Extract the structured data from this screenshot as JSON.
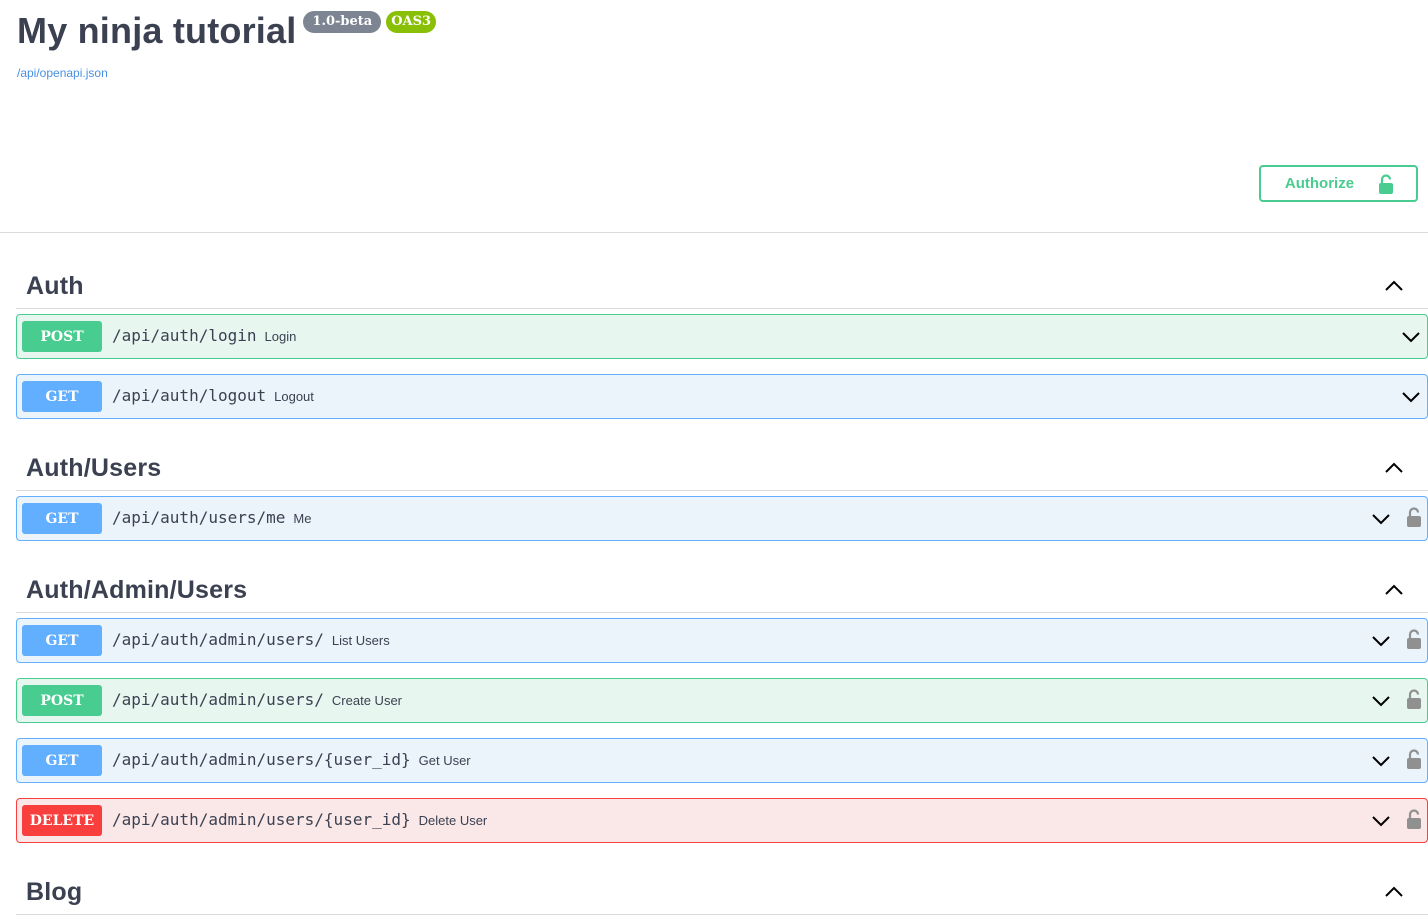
{
  "header": {
    "title": "My ninja tutorial",
    "version_badge": "1.0-beta",
    "oas_badge": "OAS3",
    "spec_link": "/api/openapi.json",
    "authorize_label": "Authorize"
  },
  "colors": {
    "get": "#61affe",
    "post": "#49cc90",
    "delete": "#f93e3e",
    "authorize": "#49cc90",
    "version_badge": "#7d8492",
    "oas_badge": "#89bf04"
  },
  "tags": [
    {
      "name": "Auth",
      "operations": [
        {
          "method": "POST",
          "path": "/api/auth/login",
          "summary": "Login",
          "locked": false
        },
        {
          "method": "GET",
          "path": "/api/auth/logout",
          "summary": "Logout",
          "locked": false
        }
      ]
    },
    {
      "name": "Auth/Users",
      "operations": [
        {
          "method": "GET",
          "path": "/api/auth/users/me",
          "summary": "Me",
          "locked": true
        }
      ]
    },
    {
      "name": "Auth/Admin/Users",
      "operations": [
        {
          "method": "GET",
          "path": "/api/auth/admin/users/",
          "summary": "List Users",
          "locked": true
        },
        {
          "method": "POST",
          "path": "/api/auth/admin/users/",
          "summary": "Create User",
          "locked": true
        },
        {
          "method": "GET",
          "path": "/api/auth/admin/users/{user_id}",
          "summary": "Get User",
          "locked": true
        },
        {
          "method": "DELETE",
          "path": "/api/auth/admin/users/{user_id}",
          "summary": "Delete User",
          "locked": true
        }
      ]
    },
    {
      "name": "Blog",
      "operations": []
    }
  ]
}
